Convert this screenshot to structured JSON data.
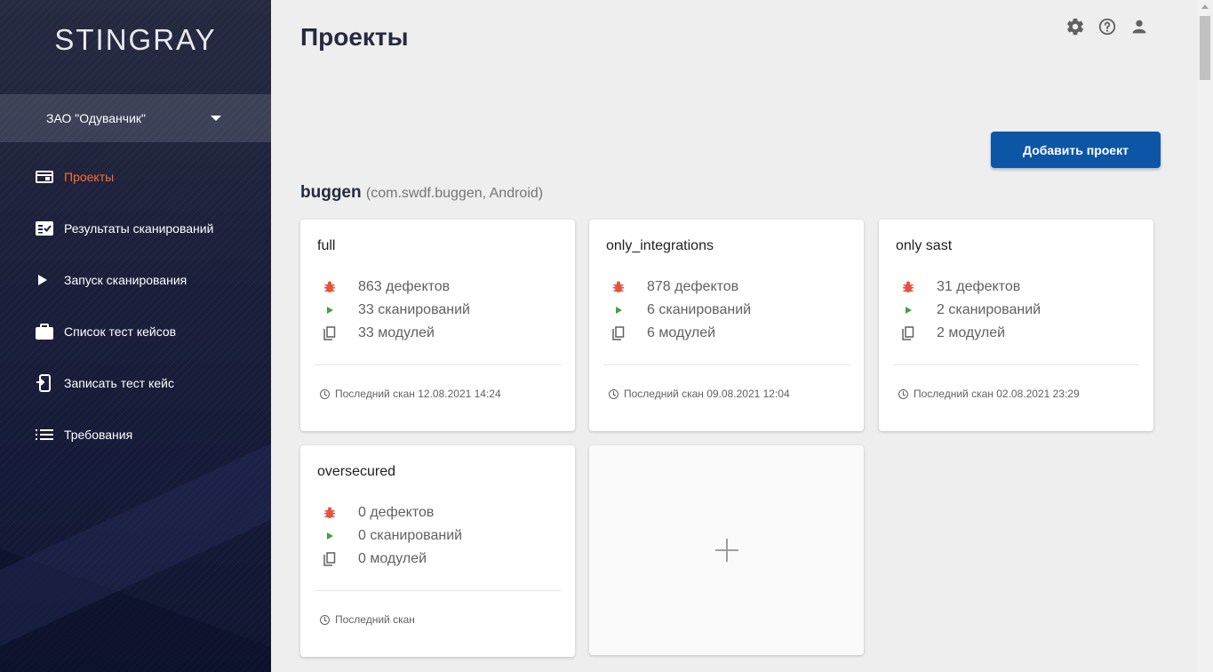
{
  "app": {
    "logo": "STINGRAY"
  },
  "sidebar": {
    "org": "ЗАО \"Одуванчик\"",
    "items": [
      {
        "label": "Проекты",
        "icon": "projects-icon",
        "active": true
      },
      {
        "label": "Результаты сканирований",
        "icon": "scan-results-icon",
        "active": false
      },
      {
        "label": "Запуск сканирования",
        "icon": "play-icon",
        "active": false
      },
      {
        "label": "Список тест кейсов",
        "icon": "briefcase-icon",
        "active": false
      },
      {
        "label": "Записать тест кейс",
        "icon": "record-phone-icon",
        "active": false
      },
      {
        "label": "Требования",
        "icon": "list-icon",
        "active": false
      }
    ]
  },
  "header": {
    "title": "Проекты",
    "icons": [
      "settings-icon",
      "help-icon",
      "account-icon"
    ]
  },
  "actions": {
    "add_project": "Добавить проект"
  },
  "group": {
    "name": "buggen",
    "subtitle": "(com.swdf.buggen, Android)"
  },
  "projects": [
    {
      "name": "full",
      "defects": "863 дефектов",
      "scans": "33 сканирований",
      "modules": "33 модулей",
      "last_scan": "Последний скан 12.08.2021 14:24"
    },
    {
      "name": "only_integrations",
      "defects": "878 дефектов",
      "scans": "6 сканирований",
      "modules": "6 модулей",
      "last_scan": "Последний скан 09.08.2021 12:04"
    },
    {
      "name": "only sast",
      "defects": "31 дефектов",
      "scans": "2 сканирований",
      "modules": "2 модулей",
      "last_scan": "Последний скан 02.08.2021 23:29"
    },
    {
      "name": "oversecured",
      "defects": "0 дефектов",
      "scans": "0 сканирований",
      "modules": "0 модулей",
      "last_scan": "Последний скан"
    }
  ],
  "add_card": {
    "symbol": "+"
  },
  "colors": {
    "accent": "#ff6d2e",
    "primary_button": "#0d56a6",
    "defect": "#e5533d",
    "scan": "#43a047"
  }
}
